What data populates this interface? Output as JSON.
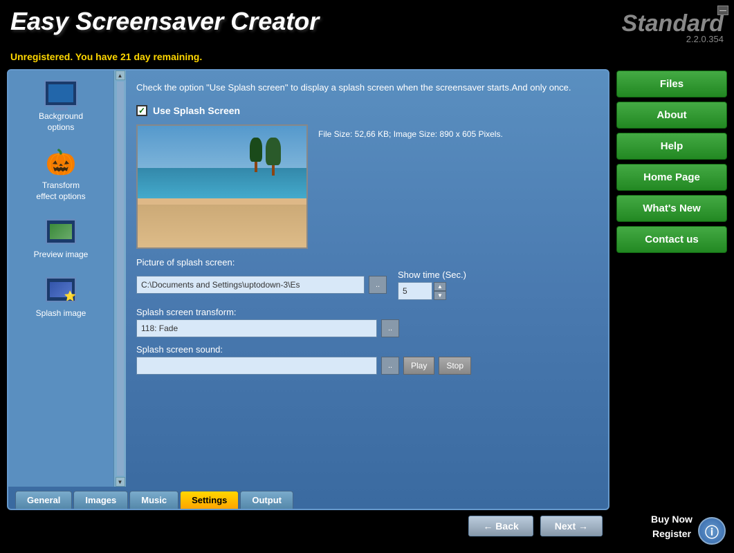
{
  "app": {
    "title": "Easy Screensaver Creator",
    "edition": "Standard",
    "version": "2.2.0.354",
    "unregistered_text": "Unregistered. You have 21 day remaining."
  },
  "sidebar": {
    "items": [
      {
        "label": "Background\noptions",
        "icon": "monitor-icon"
      },
      {
        "label": "Transform\neffect options",
        "icon": "pumpkin-icon"
      },
      {
        "label": "Preview image",
        "icon": "preview-icon"
      },
      {
        "label": "Splash image",
        "icon": "splash-icon"
      }
    ]
  },
  "content": {
    "description": "Check the option \"Use Splash screen\" to display a splash screen when the screensaver starts.And only once.",
    "use_splash_checked": true,
    "use_splash_label": "Use Splash Screen",
    "file_info": "File Size: 52,66 KB; Image Size: 890 x\n605 Pixels.",
    "picture_label": "Picture of splash screen:",
    "picture_path": "C:\\Documents and Settings\\uptodown-3\\Es",
    "show_time_label": "Show time (Sec.)",
    "show_time_value": "5",
    "transform_label": "Splash screen transform:",
    "transform_value": "118: Fade",
    "sound_label": "Splash screen sound:",
    "sound_value": "",
    "browse_label": "..",
    "play_label": "Play",
    "stop_label": "Stop"
  },
  "tabs": [
    {
      "label": "General",
      "active": false
    },
    {
      "label": "Images",
      "active": false
    },
    {
      "label": "Music",
      "active": false
    },
    {
      "label": "Settings",
      "active": true
    },
    {
      "label": "Output",
      "active": false
    }
  ],
  "nav": {
    "back_label": "← Back",
    "next_label": "Next →"
  },
  "right_menu": {
    "items": [
      {
        "label": "Files"
      },
      {
        "label": "About"
      },
      {
        "label": "Help"
      },
      {
        "label": "Home Page"
      },
      {
        "label": "What's New"
      },
      {
        "label": "Contact us"
      }
    ],
    "buy_label": "Buy Now",
    "register_label": "Register"
  },
  "info_btn_label": "ⓘ",
  "minimize_btn_label": "—"
}
